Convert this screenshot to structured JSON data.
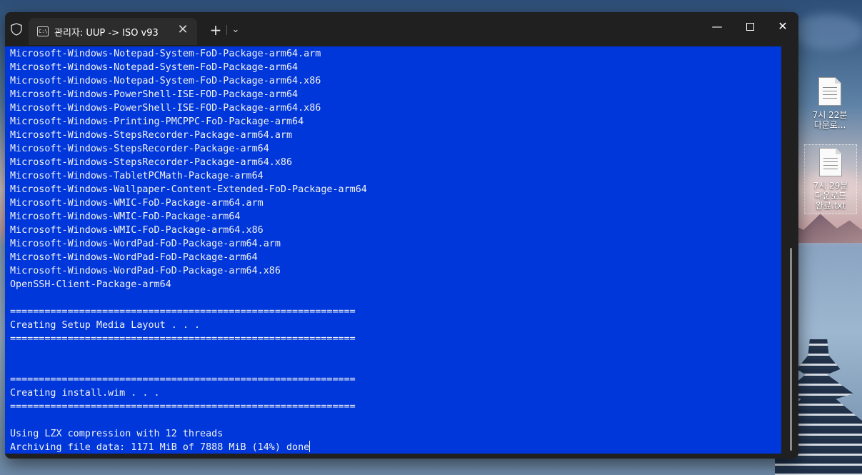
{
  "window": {
    "tab_title": "관리자:  UUP -> ISO v93",
    "tab_icon_text": "C:\\",
    "close_tab_glyph": "✕",
    "new_tab_glyph": "+",
    "dropdown_glyph": "⌄",
    "minimize_glyph": "—",
    "close_glyph": "✕"
  },
  "console": {
    "lines": [
      "Microsoft-Windows-Notepad-System-FoD-Package-arm64.arm",
      "Microsoft-Windows-Notepad-System-FoD-Package-arm64",
      "Microsoft-Windows-Notepad-System-FoD-Package-arm64.x86",
      "Microsoft-Windows-PowerShell-ISE-FOD-Package-arm64",
      "Microsoft-Windows-PowerShell-ISE-FOD-Package-arm64.x86",
      "Microsoft-Windows-Printing-PMCPPC-FoD-Package-arm64",
      "Microsoft-Windows-StepsRecorder-Package-arm64.arm",
      "Microsoft-Windows-StepsRecorder-Package-arm64",
      "Microsoft-Windows-StepsRecorder-Package-arm64.x86",
      "Microsoft-Windows-TabletPCMath-Package-arm64",
      "Microsoft-Windows-Wallpaper-Content-Extended-FoD-Package-arm64",
      "Microsoft-Windows-WMIC-FoD-Package-arm64.arm",
      "Microsoft-Windows-WMIC-FoD-Package-arm64",
      "Microsoft-Windows-WMIC-FoD-Package-arm64.x86",
      "Microsoft-Windows-WordPad-FoD-Package-arm64.arm",
      "Microsoft-Windows-WordPad-FoD-Package-arm64",
      "Microsoft-Windows-WordPad-FoD-Package-arm64.x86",
      "OpenSSH-Client-Package-arm64",
      "",
      "============================================================",
      "Creating Setup Media Layout . . .",
      "============================================================",
      "",
      "",
      "============================================================",
      "Creating install.wim . . .",
      "============================================================",
      "",
      "Using LZX compression with 12 threads"
    ],
    "current_line": "Archiving file data: 1171 MiB of 7888 MiB (14%) done"
  },
  "desktop": {
    "icons": [
      {
        "label_line1": "7시 22분",
        "label_line2": "다운로..."
      },
      {
        "label_line1": "7시 29분",
        "label_line2": "다운로드",
        "label_line3": "완료.txt"
      }
    ]
  },
  "colors": {
    "console_bg": "#0037da",
    "console_fg": "#f2f2f2",
    "titlebar_bg": "#202020",
    "tab_bg": "#2c2c2c"
  }
}
